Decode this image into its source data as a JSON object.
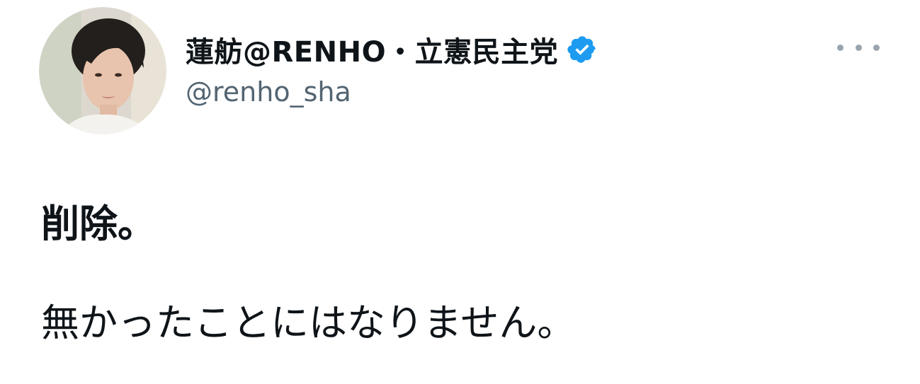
{
  "author": {
    "display_name": "蓮舫@RENHO・立憲民主党",
    "handle": "@renho_sha",
    "verified": true,
    "avatar_icon": "profile-photo"
  },
  "tweet": {
    "line1": "削除。",
    "line2": "無かったことにはなりません。"
  },
  "menu": {
    "icon": "more-options-icon"
  },
  "colors": {
    "text_primary": "#0f1419",
    "text_secondary": "#536471",
    "verified_blue": "#1d9bf0",
    "more_dots": "#9aa4ad"
  }
}
